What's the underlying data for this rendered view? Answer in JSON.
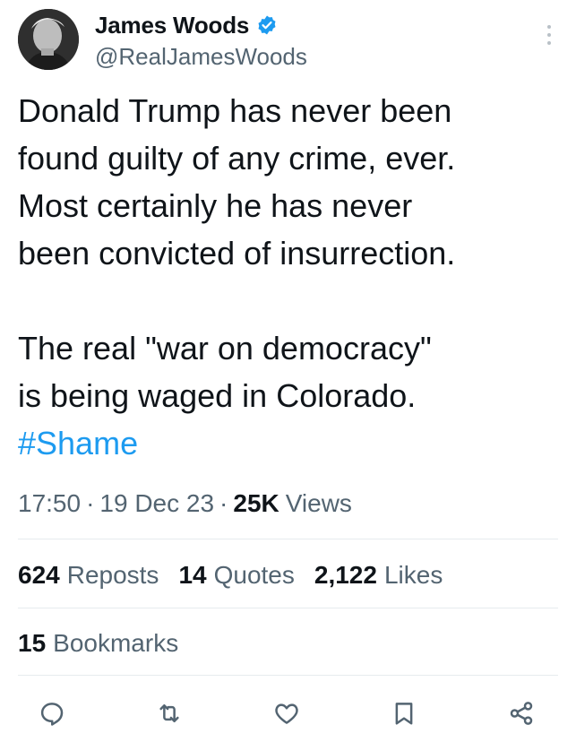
{
  "author": {
    "display_name": "James Woods",
    "handle": "@RealJamesWoods",
    "verified_color": "#1d9bf0"
  },
  "tweet": {
    "lines": [
      "Donald Trump has never been",
      "found guilty of any crime, ever.",
      "Most certainly he has never",
      "been convicted of insurrection.",
      "",
      "The real \"war on democracy\"",
      "is being waged in Colorado."
    ],
    "hashtag": "#Shame"
  },
  "meta": {
    "time": "17:50",
    "separator": "·",
    "date": "19 Dec 23",
    "views_count": "25K",
    "views_label": "Views"
  },
  "stats": {
    "reposts_count": "624",
    "reposts_label": "Reposts",
    "quotes_count": "14",
    "quotes_label": "Quotes",
    "likes_count": "2,122",
    "likes_label": "Likes",
    "bookmarks_count": "15",
    "bookmarks_label": "Bookmarks"
  },
  "actions": {
    "icons": [
      "reply-icon",
      "repost-icon",
      "like-icon",
      "bookmark-icon",
      "share-icon"
    ]
  },
  "colors": {
    "text": "#0f1419",
    "secondary": "#536471",
    "accent": "#1d9bf0",
    "divider": "#e6ebee"
  }
}
